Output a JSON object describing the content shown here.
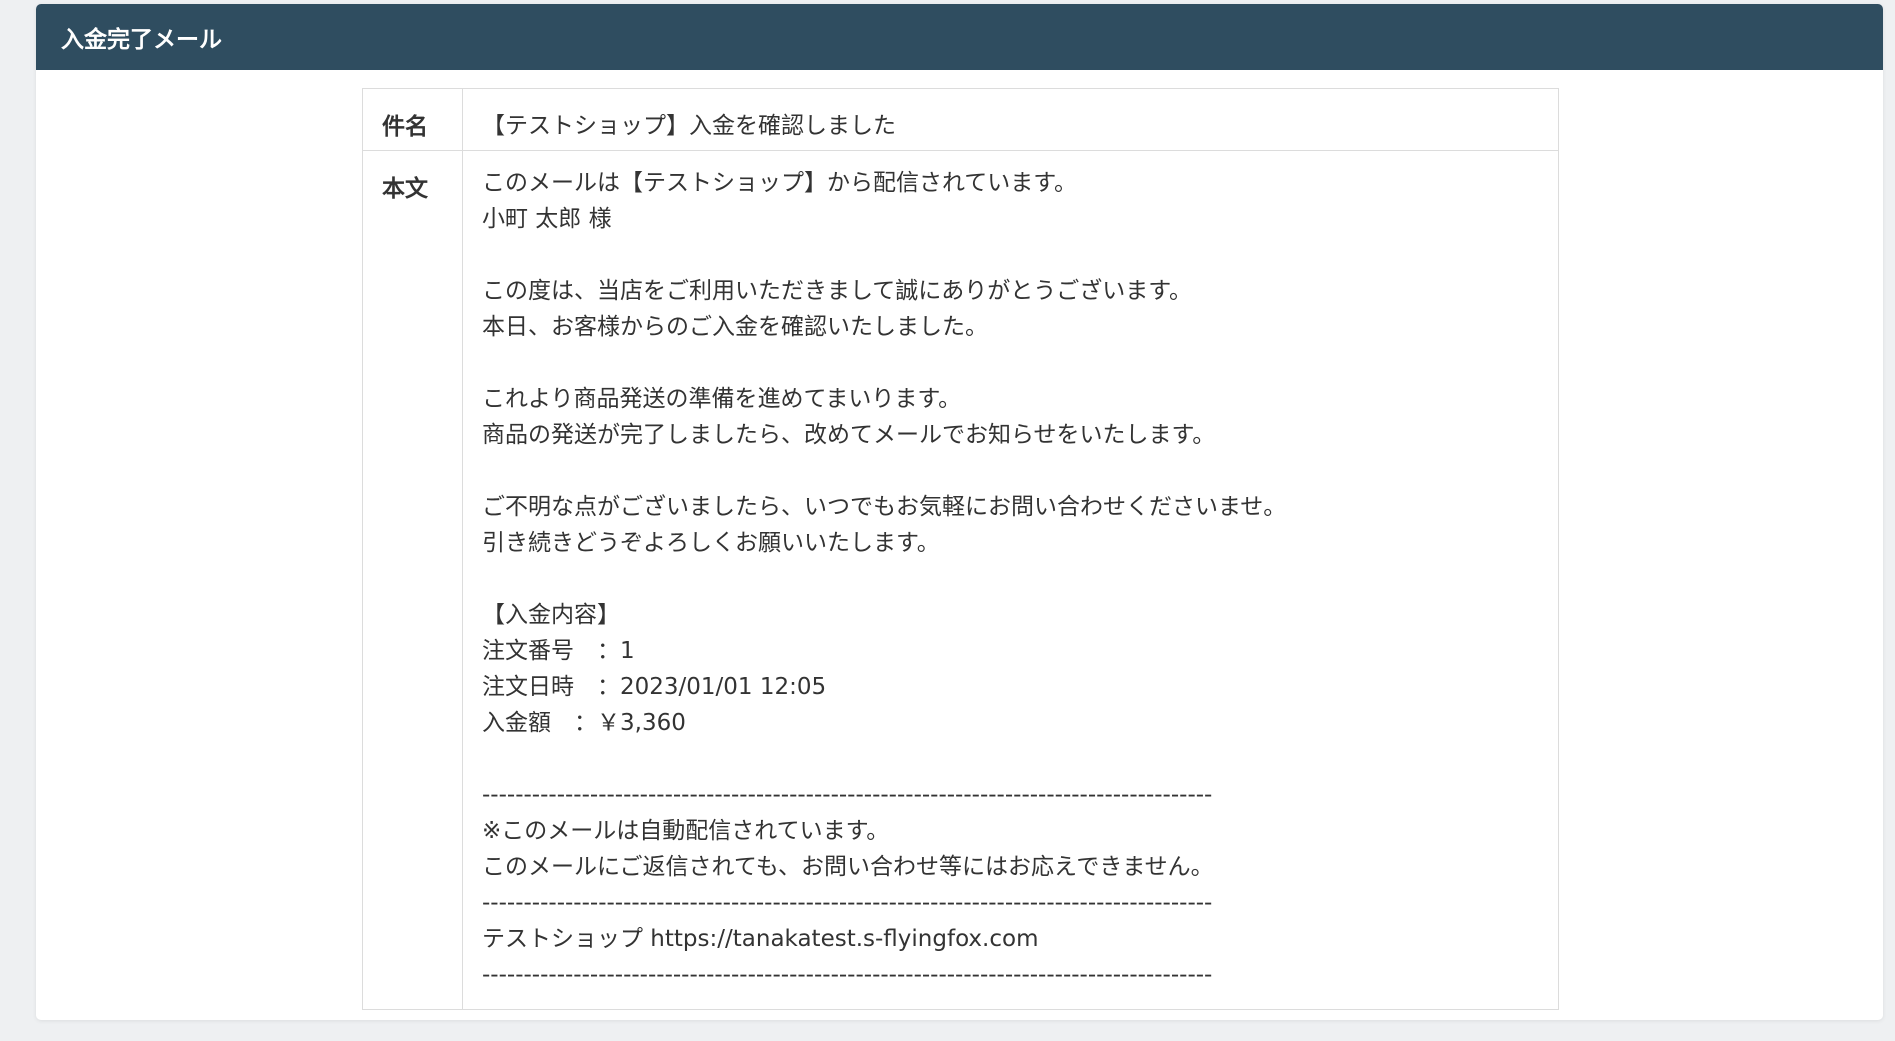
{
  "header": {
    "title": "入金完了メール"
  },
  "subject_row": {
    "label": "件名",
    "value": "【テストショップ】入金を確認しました"
  },
  "body_row": {
    "label": "本文",
    "lines": [
      "このメールは【テストショップ】から配信されています。",
      "小町 太郎 様",
      "",
      "この度は、当店をご利用いただきまして誠にありがとうございます。",
      "本日、お客様からのご入金を確認いたしました。",
      "",
      "これより商品発送の準備を進めてまいります。",
      "商品の発送が完了しましたら、改めてメールでお知らせをいたします。",
      "",
      "ご不明な点がございましたら、いつでもお気軽にお問い合わせくださいませ。",
      "引き続きどうぞよろしくお願いいたします。",
      "",
      "【入金内容】",
      "注文番号　：1",
      "注文日時　：2023/01/01 12:05",
      "入金額　：￥3,360",
      "",
      "----------------------------------------------------------------------------------------",
      "※このメールは自動配信されています。",
      "このメールにご返信されても、お問い合わせ等にはお応えできません。",
      "----------------------------------------------------------------------------------------",
      "テストショップ https://tanakatest.s-flyingfox.com",
      "----------------------------------------------------------------------------------------"
    ]
  },
  "colors": {
    "header_bg": "#2f4d60",
    "page_bg": "#eef0f2",
    "border": "#dcdcdc",
    "text": "#333333"
  }
}
